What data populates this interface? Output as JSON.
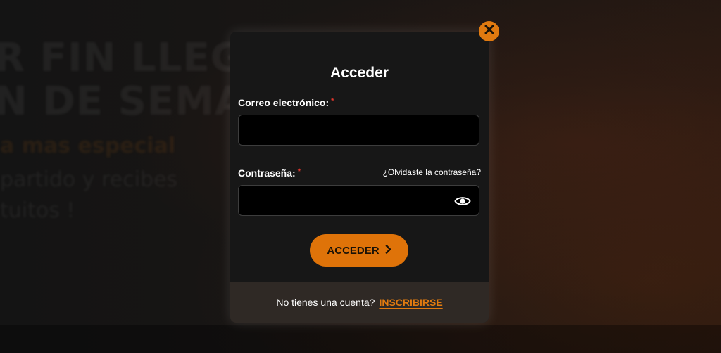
{
  "background": {
    "headline_1": "R FIN LLEG",
    "headline_2": "N DE SEMA",
    "orange_line": "a mas especial",
    "sub_1": "partido y recibes",
    "sub_2": "tuitos !"
  },
  "modal": {
    "title": "Acceder",
    "email_label": "Correo electrónico:",
    "password_label": "Contraseña:",
    "required_mark": "*",
    "forgot_link": "¿Olvidaste la contraseña?",
    "email_value": "",
    "password_value": "",
    "submit_label": "ACCEDER",
    "footer_question": "No tienes una cuenta?",
    "signup_link": "INSCRIBIRSE"
  },
  "colors": {
    "accent": "#df7309",
    "modal_bg": "#171717",
    "footer_bg": "#2f2925",
    "required": "#e0362c"
  },
  "icons": {
    "close": "close-icon",
    "eye": "eye-icon",
    "chevron": "chevron-right-icon"
  }
}
